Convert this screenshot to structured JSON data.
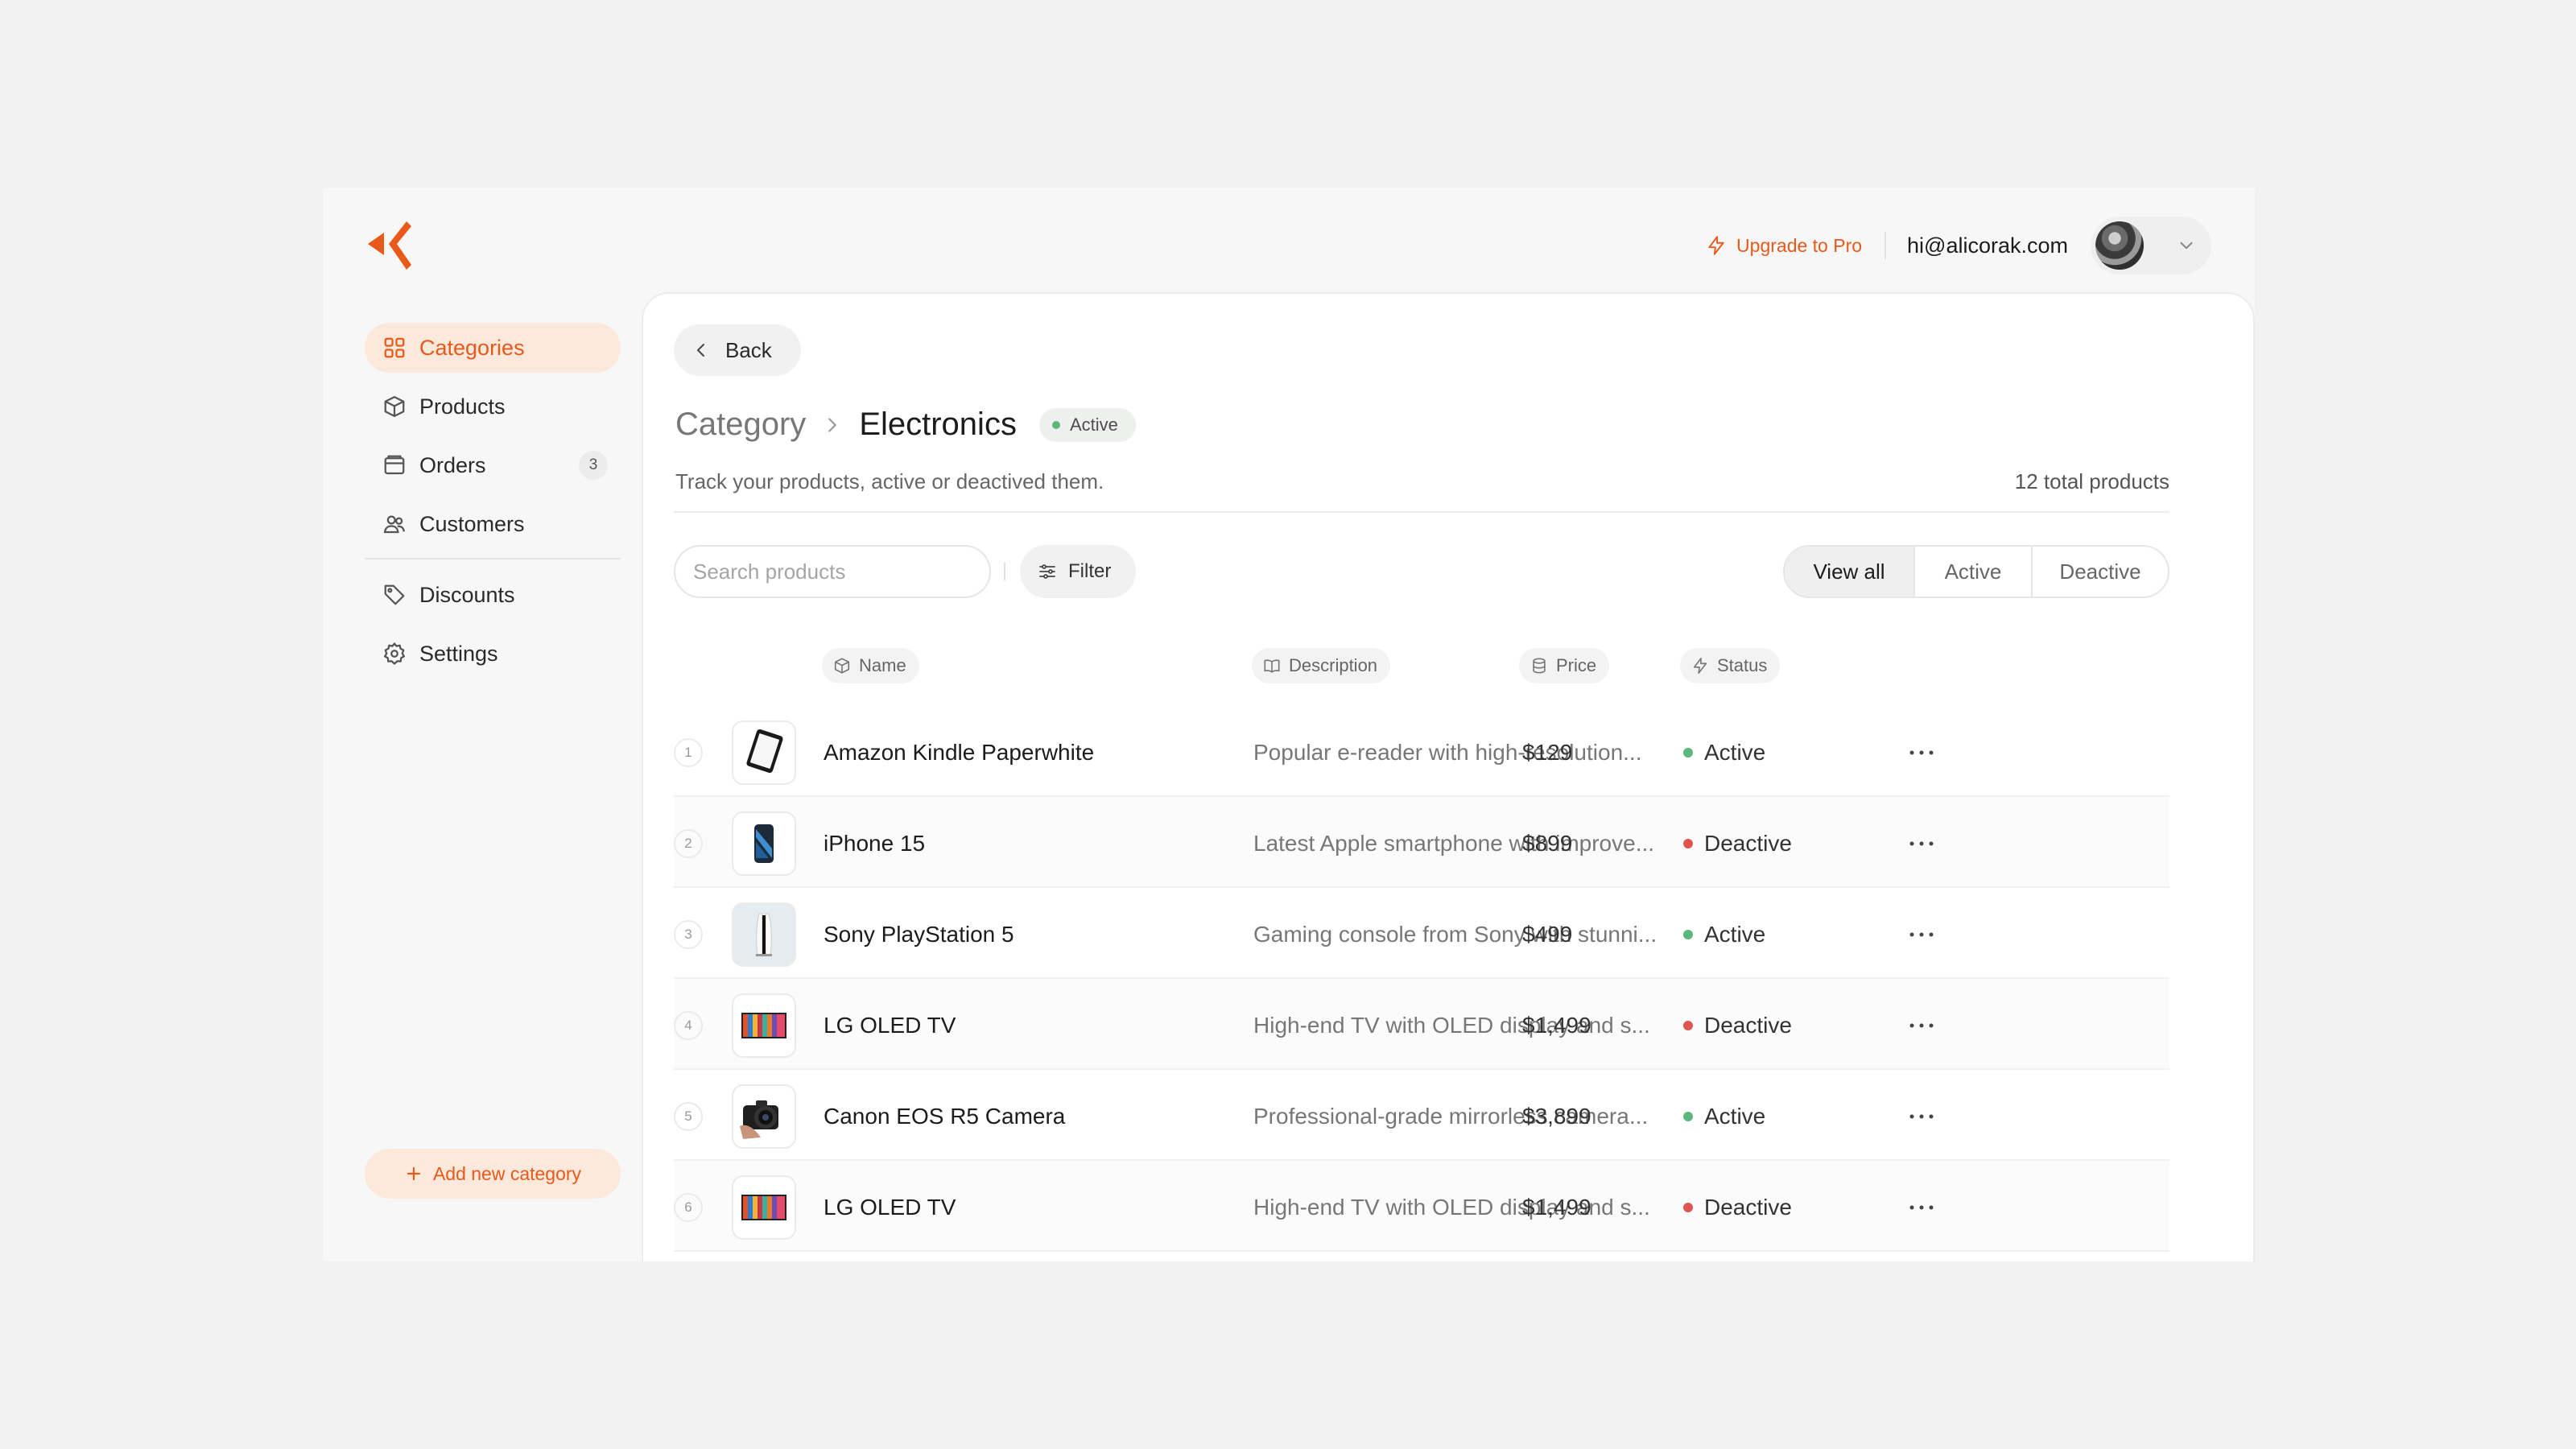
{
  "brand": {
    "accent": "#e8591a",
    "accent_soft": "#fde8dc",
    "logo_icon": "brand-logo-icon"
  },
  "sidebar": {
    "items": [
      {
        "label": "Categories",
        "icon": "grid-icon",
        "active": true
      },
      {
        "label": "Products",
        "icon": "box-icon"
      },
      {
        "label": "Orders",
        "icon": "inbox-icon",
        "badge": "3"
      },
      {
        "label": "Customers",
        "icon": "users-icon"
      },
      {
        "label": "Discounts",
        "icon": "tag-icon"
      },
      {
        "label": "Settings",
        "icon": "gear-icon"
      }
    ],
    "add_button": "Add new category"
  },
  "topbar": {
    "upgrade_label": "Upgrade to Pro",
    "email": "hi@alicorak.com"
  },
  "page": {
    "back_label": "Back",
    "breadcrumb_parent": "Category",
    "breadcrumb_current": "Electronics",
    "status_badge": "Active",
    "subtitle": "Track your products, active or deactived them.",
    "total_label": "12 total products"
  },
  "toolbar": {
    "search_placeholder": "Search products",
    "filter_label": "Filter",
    "segments": [
      "View all",
      "Active",
      "Deactive"
    ],
    "selected_segment": "View all"
  },
  "table": {
    "columns": [
      {
        "label": "Name",
        "icon": "cube-icon"
      },
      {
        "label": "Description",
        "icon": "book-icon"
      },
      {
        "label": "Price",
        "icon": "database-icon"
      },
      {
        "label": "Status",
        "icon": "bolt-icon"
      }
    ],
    "rows": [
      {
        "num": "1",
        "name": "Amazon Kindle Paperwhite",
        "description": "Popular e-reader with high-resolution...",
        "price": "$129",
        "status": "Active",
        "thumb": "kindle"
      },
      {
        "num": "2",
        "name": "iPhone 15",
        "description": "Latest Apple smartphone with improve...",
        "price": "$899",
        "status": "Deactive",
        "thumb": "iphone"
      },
      {
        "num": "3",
        "name": "Sony PlayStation 5",
        "description": "Gaming console from Sony with stunni...",
        "price": "$499",
        "status": "Active",
        "thumb": "ps5"
      },
      {
        "num": "4",
        "name": "LG OLED TV",
        "description": "High-end TV with OLED display and s...",
        "price": "$1,499",
        "status": "Deactive",
        "thumb": "tv"
      },
      {
        "num": "5",
        "name": "Canon EOS R5 Camera",
        "description": "Professional-grade mirrorless camera...",
        "price": "$3,899",
        "status": "Active",
        "thumb": "camera"
      },
      {
        "num": "6",
        "name": "LG OLED TV",
        "description": "High-end TV with OLED display and s...",
        "price": "$1,499",
        "status": "Deactive",
        "thumb": "tv"
      }
    ]
  },
  "status_colors": {
    "Active": "#5bb87a",
    "Deactive": "#e0554f"
  }
}
